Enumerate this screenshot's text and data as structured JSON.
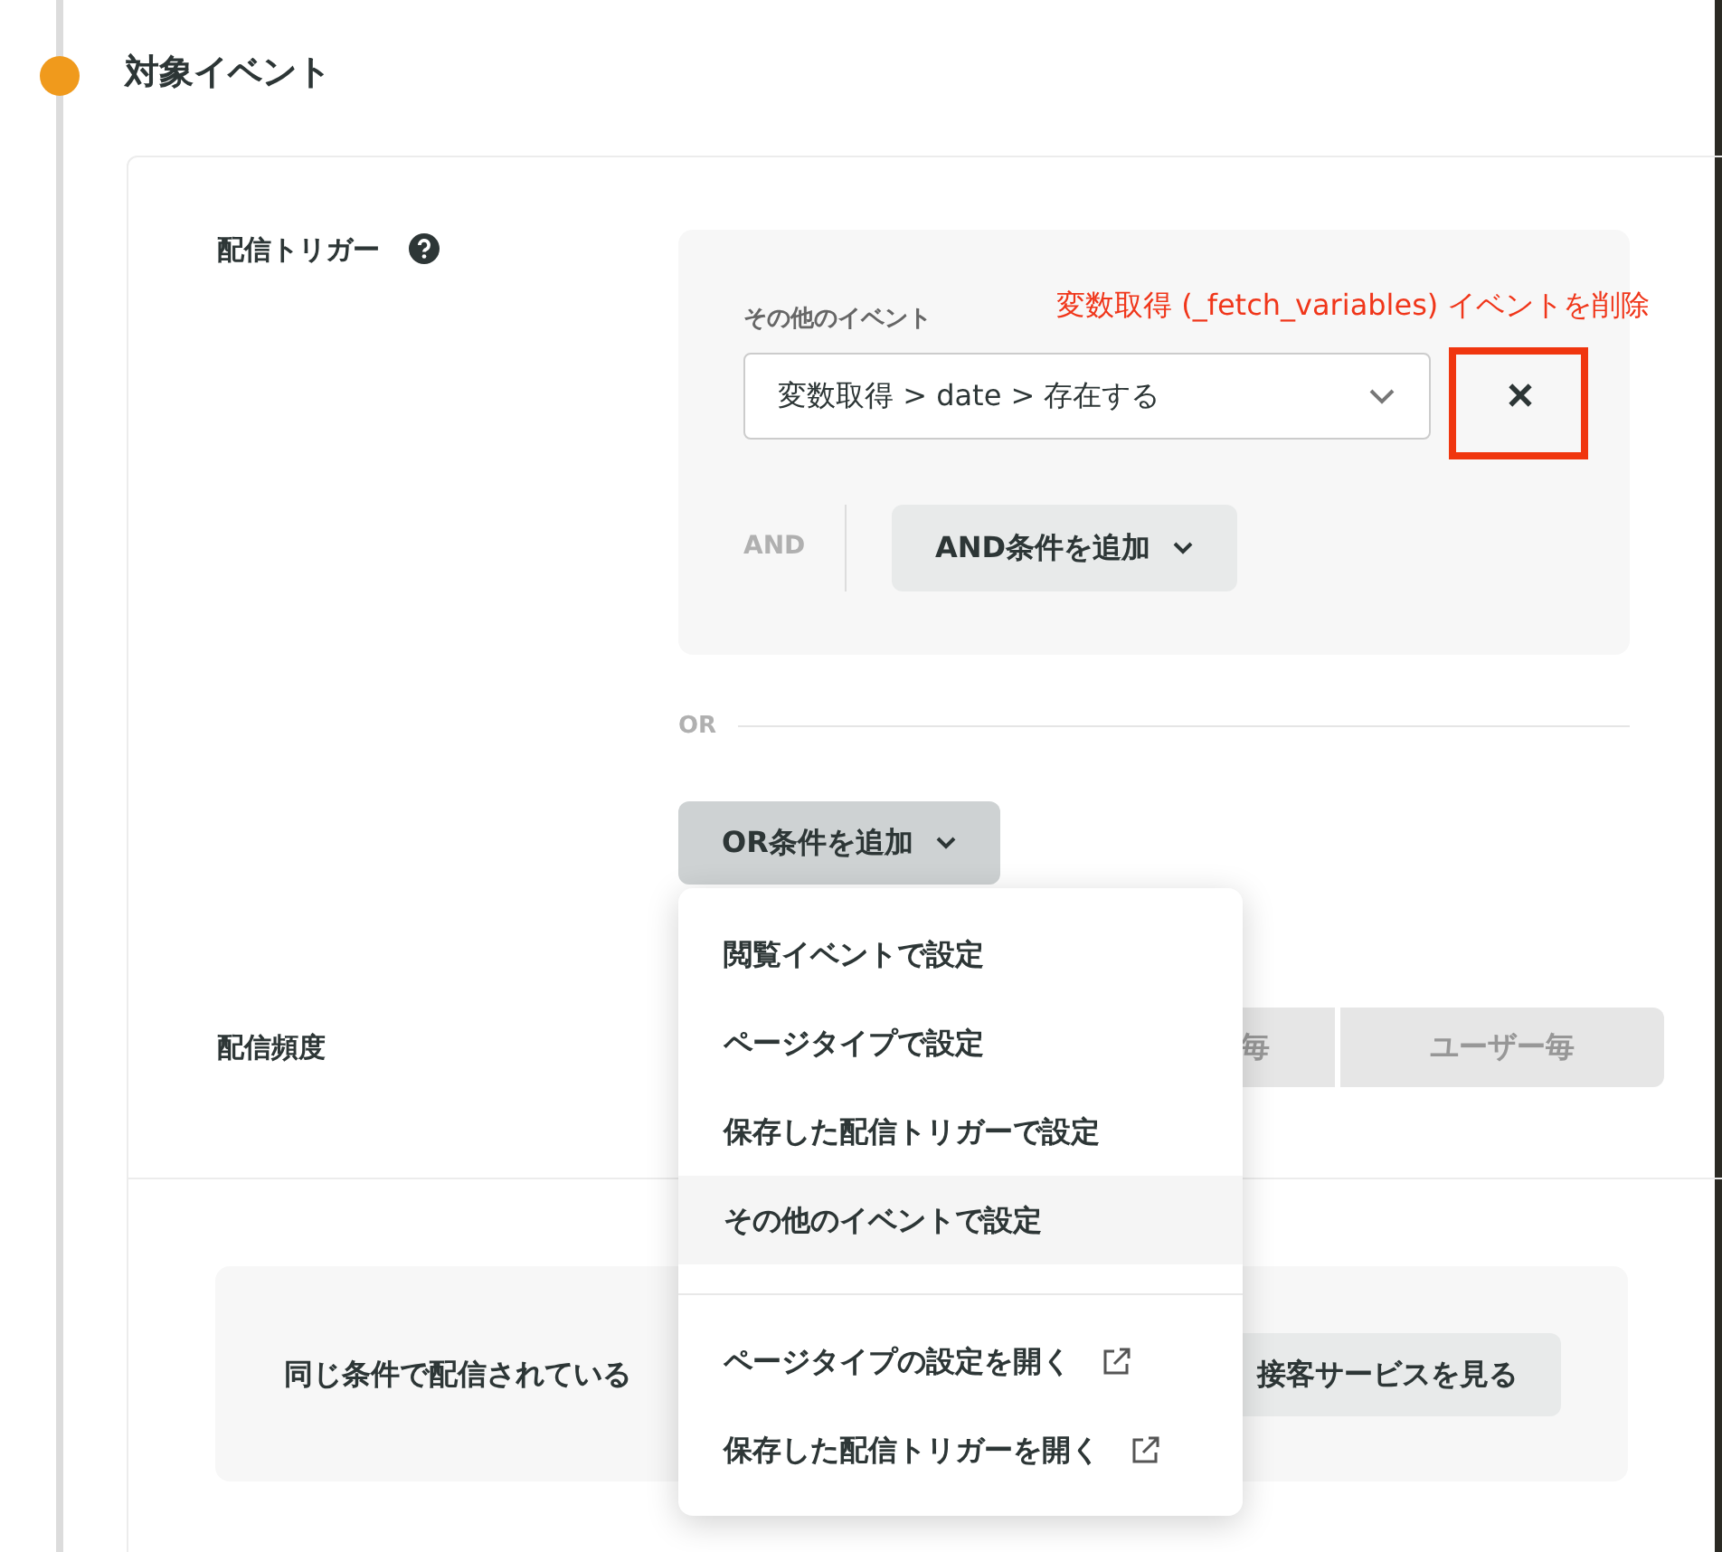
{
  "section": {
    "title": "対象イベント"
  },
  "trigger": {
    "label": "配信トリガー",
    "event_label": "その他のイベント",
    "event_value": "変数取得 > date > 存在する",
    "and_label": "AND",
    "and_button": "AND条件を追加",
    "or_label": "OR",
    "or_button": "OR条件を追加",
    "menu_open": true
  },
  "annotation": {
    "text": "変数取得 (_fetch_variables) イベントを削除"
  },
  "menu": {
    "groups": [
      [
        {
          "label": "閲覧イベントで設定",
          "highlighted": false,
          "external": false
        },
        {
          "label": "ページタイプで設定",
          "highlighted": false,
          "external": false
        },
        {
          "label": "保存した配信トリガーで設定",
          "highlighted": false,
          "external": false
        },
        {
          "label": "その他のイベントで設定",
          "highlighted": true,
          "external": false
        }
      ],
      [
        {
          "label": "ページタイプの設定を開く",
          "highlighted": false,
          "external": true
        },
        {
          "label": "保存した配信トリガーを開く",
          "highlighted": false,
          "external": true
        }
      ]
    ]
  },
  "frequency": {
    "label": "配信頻度",
    "options": [
      {
        "label": "毎",
        "disabled": true
      },
      {
        "label": "ユーザー毎",
        "disabled": true
      }
    ]
  },
  "related": {
    "text": "同じ条件で配信されている",
    "button": "接客サービスを見る"
  }
}
